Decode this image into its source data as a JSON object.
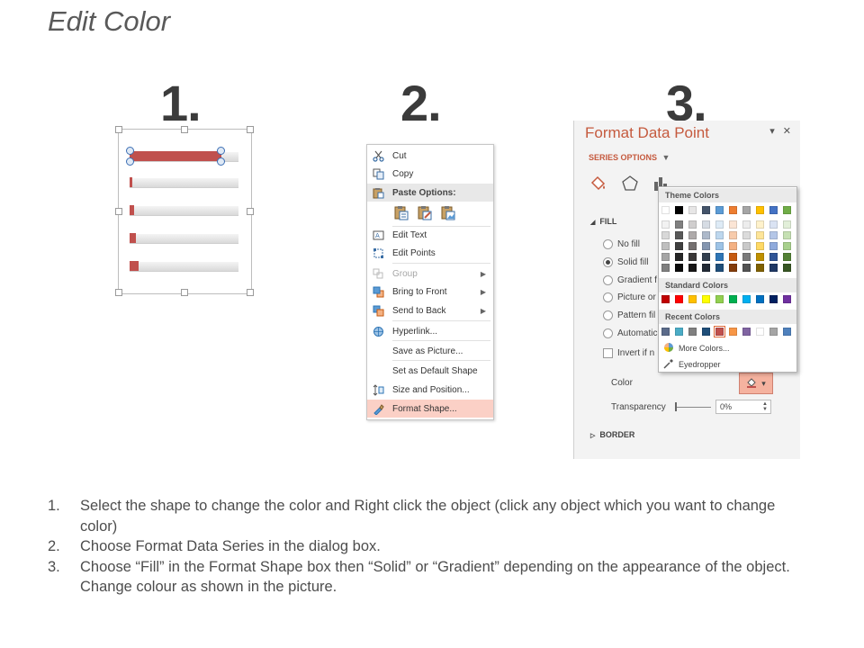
{
  "title": "Edit Color",
  "steps": [
    "1.",
    "2.",
    "3."
  ],
  "context_menu": {
    "items": [
      {
        "label": "Cut",
        "icon": "scissors-icon",
        "state": "normal"
      },
      {
        "label": "Copy",
        "icon": "copy-icon",
        "state": "normal"
      },
      {
        "label": "Paste Options:",
        "icon": "paste-icon",
        "state": "header"
      },
      {
        "label": "Edit Text",
        "icon": "edit-text-icon",
        "state": "normal"
      },
      {
        "label": "Edit Points",
        "icon": "edit-points-icon",
        "state": "normal"
      },
      {
        "label": "Group",
        "icon": "group-icon",
        "state": "disabled",
        "submenu": true
      },
      {
        "label": "Bring to Front",
        "icon": "bring-front-icon",
        "state": "normal",
        "submenu": true
      },
      {
        "label": "Send to Back",
        "icon": "send-back-icon",
        "state": "normal",
        "submenu": true
      },
      {
        "label": "Hyperlink...",
        "icon": "hyperlink-icon",
        "state": "normal"
      },
      {
        "label": "Save as Picture...",
        "icon": "",
        "state": "normal"
      },
      {
        "label": "Set as Default Shape",
        "icon": "",
        "state": "normal"
      },
      {
        "label": "Size and Position...",
        "icon": "size-position-icon",
        "state": "normal"
      },
      {
        "label": "Format Shape...",
        "icon": "format-shape-icon",
        "state": "highlighted"
      }
    ]
  },
  "format_pane": {
    "title": "Format Data Point",
    "close": "✕",
    "pin": "▾",
    "series_options": "SERIES OPTIONS",
    "fill_header": "FILL",
    "fill_options": [
      {
        "label": "No fill",
        "selected": false
      },
      {
        "label": "Solid fill",
        "selected": true
      },
      {
        "label": "Gradient f",
        "selected": false
      },
      {
        "label": "Picture or",
        "selected": false
      },
      {
        "label": "Pattern fil",
        "selected": false
      },
      {
        "label": "Automatic",
        "selected": false
      }
    ],
    "invert": "Invert if n",
    "color_label": "Color",
    "transparency_label": "Transparency",
    "transparency_value": "0%",
    "border_header": "BORDER"
  },
  "palette": {
    "theme_header": "Theme Colors",
    "standard_header": "Standard Colors",
    "recent_header": "Recent Colors",
    "more_colors": "More Colors...",
    "eyedropper": "Eyedropper",
    "theme_top": [
      "#ffffff",
      "#000000",
      "#e7e6e6",
      "#44546a",
      "#5b9bd5",
      "#ed7d31",
      "#a5a5a5",
      "#ffc000",
      "#4472c4",
      "#70ad47"
    ],
    "theme_shades": [
      [
        "#f2f2f2",
        "#808080",
        "#d0cece",
        "#d6dce4",
        "#deebf6",
        "#fbe5d5",
        "#ededed",
        "#fff2cc",
        "#dae3f3",
        "#e2efd9"
      ],
      [
        "#d8d8d8",
        "#595959",
        "#aeaaaa",
        "#adb9ca",
        "#bdd7ee",
        "#f7cbac",
        "#dbdbdb",
        "#fee599",
        "#b4c6e7",
        "#c5e0b3"
      ],
      [
        "#bfbfbf",
        "#3f3f3f",
        "#757070",
        "#8496b0",
        "#9dc3e6",
        "#f4b183",
        "#c9c9c9",
        "#ffd965",
        "#8faadc",
        "#a8d08d"
      ],
      [
        "#a5a5a5",
        "#262626",
        "#3a3838",
        "#323f4f",
        "#2e75b5",
        "#c55a11",
        "#7b7b7b",
        "#bf9000",
        "#2f5496",
        "#538135"
      ],
      [
        "#7f7f7f",
        "#0c0c0c",
        "#171616",
        "#222a35",
        "#1f4e79",
        "#833c0b",
        "#525252",
        "#7f6000",
        "#1f3864",
        "#375623"
      ]
    ],
    "standard": [
      "#c00000",
      "#ff0000",
      "#ffc000",
      "#ffff00",
      "#92d050",
      "#00b050",
      "#00b0f0",
      "#0070c0",
      "#002060",
      "#7030a0"
    ],
    "recent": [
      "#5b6b8a",
      "#4bacc6",
      "#808080",
      "#1f4e79",
      "#c0504d",
      "#f79646",
      "#8064a2",
      "#ffffff",
      "#a5a5a5",
      "#4f81bd"
    ]
  },
  "instructions": [
    {
      "num": "1.",
      "text": "Select the shape to change the color and Right click the object (click any object which you want to change color)"
    },
    {
      "num": "2.",
      "text": "Choose Format Data Series in the dialog box."
    },
    {
      "num": "3.",
      "text": "Choose “Fill” in the Format Shape box then “Solid” or “Gradient” depending on the appearance of the object. Change colour as shown in the picture."
    }
  ],
  "accent": "#c0504d"
}
